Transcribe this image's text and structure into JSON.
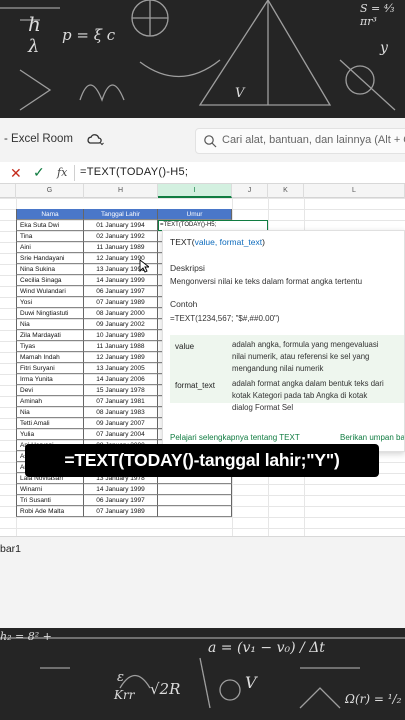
{
  "app": {
    "title": "- Excel Room",
    "search_placeholder": "Cari alat, bantuan, dan lainnya (Alt + Q)",
    "accent_color": "#107c41",
    "header_color": "#4a77c9"
  },
  "formula_bar": {
    "cancel_symbol": "✕",
    "enter_symbol": "✓",
    "fx_label": "fx",
    "formula": "=TEXT(TODAY()-H5;"
  },
  "columns": [
    "G",
    "H",
    "I",
    "J",
    "K",
    "L"
  ],
  "table": {
    "headers": [
      "Nama",
      "Tanggal Lahir",
      "Umur"
    ],
    "active_cell_text": "=TEXT(TODAY()-H5;",
    "rows": [
      [
        "Eka Suta Dwi",
        "01 January 1994"
      ],
      [
        "Tina",
        "02 January 1992"
      ],
      [
        "Aini",
        "11 January 1989"
      ],
      [
        "Srie Handayani",
        "12 January 1990"
      ],
      [
        "Nina Sukina",
        "13 January 1991"
      ],
      [
        "Cecilia Sinaga",
        "14 January 1999"
      ],
      [
        "Wind Wulandari",
        "06 January 1997"
      ],
      [
        "Yosi",
        "07 January 1989"
      ],
      [
        "Duwi Ningtiastuti",
        "08 January 2000"
      ],
      [
        "Nia",
        "09 January 2002"
      ],
      [
        "Zila Mardayati",
        "10 January 1989"
      ],
      [
        "Tiyas",
        "11 January 1988"
      ],
      [
        "Mamah Indah",
        "12 January 1989"
      ],
      [
        "Fitri Suryani",
        "13 January 2005"
      ],
      [
        "Irma Yunita",
        "14 January 2006"
      ],
      [
        "Devi",
        "15 January 1978"
      ],
      [
        "Aminah",
        "07 January 1981"
      ],
      [
        "Nia",
        "08 January 1983"
      ],
      [
        "Tetti Amali",
        "09 January 2007"
      ],
      [
        "Yulia",
        "07 January 2004"
      ],
      [
        "Ani Heryani",
        "08 January 2000"
      ],
      [
        "Asnah",
        "01 January 2000"
      ],
      [
        "Ariyati",
        "12 January 1990"
      ],
      [
        "Lala Novitasari",
        "13 January 1978"
      ],
      [
        "Winarni",
        "14 January 1999"
      ],
      [
        "Tri Susanti",
        "06 January 1997"
      ],
      [
        "Robi Ade Malta",
        "07 January 1989"
      ]
    ]
  },
  "tooltip": {
    "signature_fn": "TEXT(",
    "signature_args": "value, format_text",
    "signature_close": ")",
    "description_heading": "Deskripsi",
    "description": "Mengonversi nilai ke teks dalam format angka tertentu",
    "example_heading": "Contoh",
    "example": "=TEXT(1234,567; \"$#,##0.00\")",
    "params": [
      {
        "name": "value",
        "lines": [
          "adalah angka, formula yang mengevaluasi",
          "nilai numerik, atau referensi ke sel yang",
          "mengandung nilai numerik"
        ]
      },
      {
        "name": "format_text",
        "lines": [
          "adalah format angka dalam bentuk teks dari",
          "kotak Kategori pada tab Angka di kotak",
          "dialog Format Sel"
        ]
      }
    ],
    "learn_more": "Pelajari selengkapnya tentang TEXT",
    "feedback": "Berikan umpan balik"
  },
  "sheet_tab": "bar1",
  "caption": "=TEXT(TODAY()-tanggal lahir;\"Y\")",
  "chalkboard": {
    "top_formulas": [
      "h",
      "λ",
      "p = ξ c",
      "V",
      "Q",
      "S = ⁴⁄₃ πr³",
      "F",
      "M",
      "x",
      "y"
    ],
    "bottom_formulas": [
      "h₂ = 8² + ",
      "ε",
      "Krr",
      "√2R",
      "a = (v₁ − v₀) / Δt",
      "V",
      "Ω(r) = ¹/₂"
    ]
  }
}
